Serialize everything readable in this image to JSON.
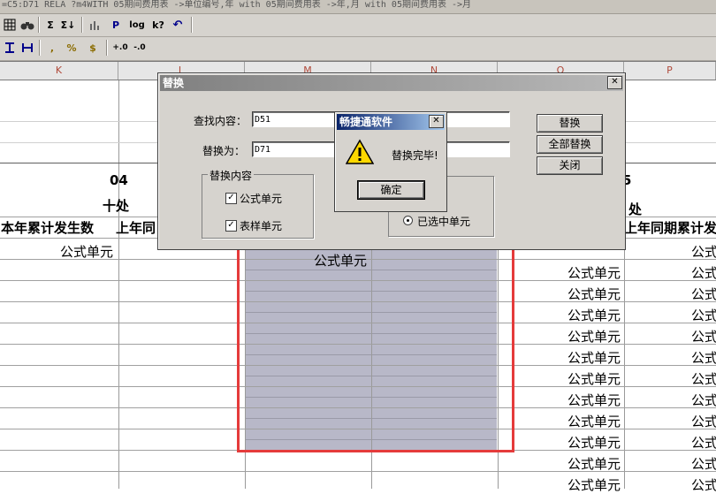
{
  "formula_bar": "=C5:D71 RELA ?m4WITH  05期间费用表 ->单位编号,年 with  05期间费用表 ->年,月 with  05期间费用表 ->月",
  "toolbar": {
    "sum": "Σ",
    "sum_col": "Σ↓",
    "p": "P",
    "log": "log",
    "help": "k?",
    "undo": "↶",
    "comma": ",",
    "percent": "%",
    "currency": "$",
    "dec_inc": "+.0",
    "dec_dec": "-.0"
  },
  "columns": [
    "K",
    "L",
    "M",
    "N",
    "O",
    "P"
  ],
  "sheet": {
    "code_k": "04",
    "code_p": "5",
    "dept_k": "十处",
    "dept_p": "处",
    "hdr_k": "本年累计发生数",
    "hdr_l": "上年同",
    "hdr_p": "上年同期累计发",
    "formula_cell": "公式单元",
    "m_cell": "公式单元"
  },
  "replace_dialog": {
    "title": "替换",
    "find_label": "查找内容：",
    "find_value": "D51",
    "replace_label": "替换为：",
    "replace_value": "D71",
    "group_title": "替换内容",
    "check_formula": "公式单元",
    "check_sample": "表样单元",
    "radio_selected": "已选中单元",
    "btn_replace": "替换",
    "btn_replace_all": "全部替换",
    "btn_close": "关闭",
    "close_glyph": "✕"
  },
  "message_box": {
    "title": "畅捷通软件",
    "message": "替换完毕!",
    "ok": "确定",
    "close_glyph": "✕"
  }
}
